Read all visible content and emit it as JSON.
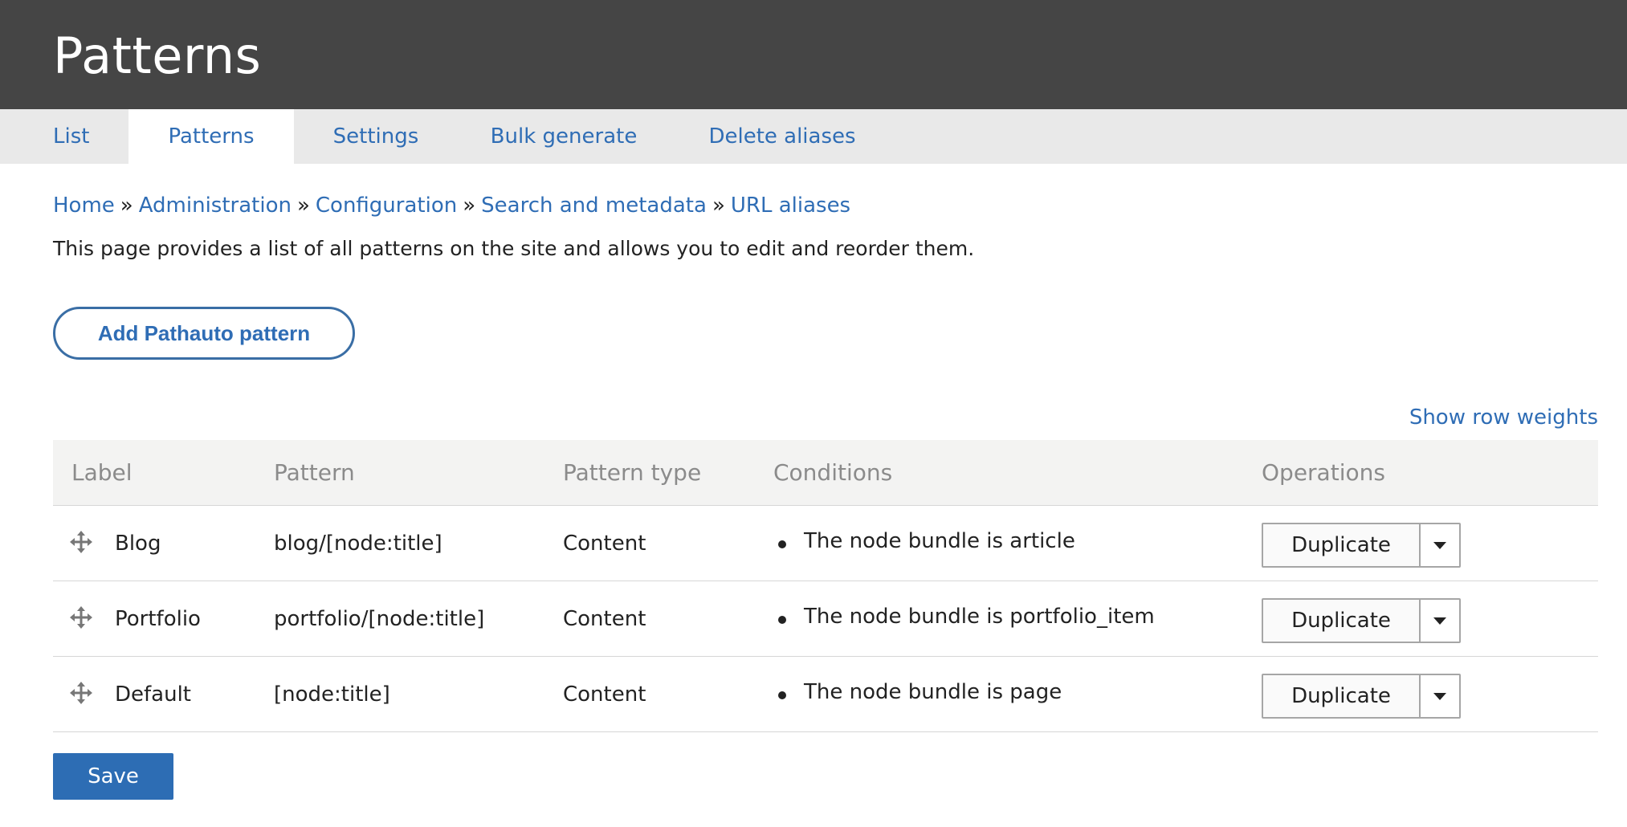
{
  "page_title": "Patterns",
  "tabs": [
    {
      "label": "List",
      "active": false
    },
    {
      "label": "Patterns",
      "active": true
    },
    {
      "label": "Settings",
      "active": false
    },
    {
      "label": "Bulk generate",
      "active": false
    },
    {
      "label": "Delete aliases",
      "active": false
    }
  ],
  "breadcrumb": [
    {
      "label": "Home"
    },
    {
      "label": "Administration"
    },
    {
      "label": "Configuration"
    },
    {
      "label": "Search and metadata"
    },
    {
      "label": "URL aliases"
    }
  ],
  "breadcrumb_separator": "»",
  "description": "This page provides a list of all patterns on the site and allows you to edit and reorder them.",
  "add_button": "Add Pathauto pattern",
  "row_weights_link": "Show row weights",
  "table": {
    "headers": {
      "label": "Label",
      "pattern": "Pattern",
      "pattern_type": "Pattern type",
      "conditions": "Conditions",
      "operations": "Operations"
    },
    "rows": [
      {
        "label": "Blog",
        "pattern": "blog/[node:title]",
        "pattern_type": "Content",
        "condition": "The node bundle is article",
        "operation": "Duplicate"
      },
      {
        "label": "Portfolio",
        "pattern": "portfolio/[node:title]",
        "pattern_type": "Content",
        "condition": "The node bundle is portfolio_item",
        "operation": "Duplicate"
      },
      {
        "label": "Default",
        "pattern": "[node:title]",
        "pattern_type": "Content",
        "condition": "The node bundle is page",
        "operation": "Duplicate"
      }
    ]
  },
  "save_button": "Save",
  "icons": {
    "drag_handle": "drag-handle-icon",
    "dropdown": "chevron-down-icon"
  },
  "colors": {
    "header_bg": "#454545",
    "tabs_bg": "#e9e9e9",
    "link": "#2f6db5",
    "primary_button": "#2d6db4",
    "table_header_bg": "#f3f3f2"
  }
}
